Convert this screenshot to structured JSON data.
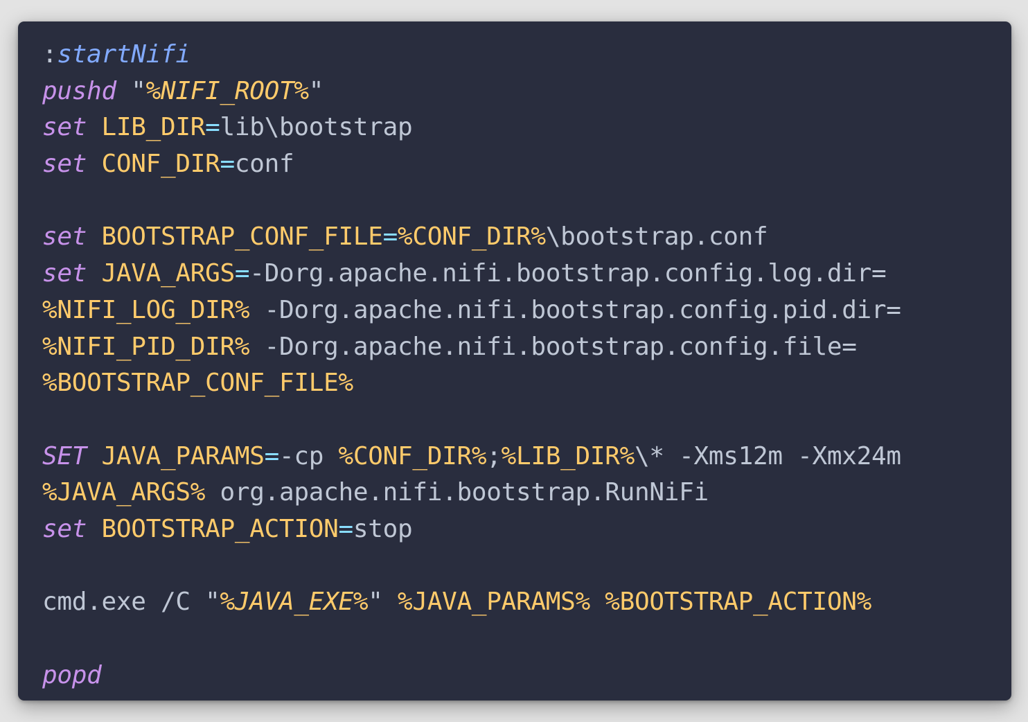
{
  "code": {
    "lines": [
      [
        {
          "t": ":",
          "k": "label-colon"
        },
        {
          "t": "startNifi",
          "k": "label-name"
        }
      ],
      [
        {
          "t": "pushd",
          "k": "kw"
        },
        {
          "t": " \"",
          "k": "plain"
        },
        {
          "t": "%NIFI_ROOT%",
          "k": "var-italic"
        },
        {
          "t": "\"",
          "k": "plain"
        }
      ],
      [
        {
          "t": "set",
          "k": "kw"
        },
        {
          "t": " ",
          "k": "plain"
        },
        {
          "t": "LIB_DIR",
          "k": "var"
        },
        {
          "t": "=",
          "k": "op"
        },
        {
          "t": "lib\\bootstrap",
          "k": "plain"
        }
      ],
      [
        {
          "t": "set",
          "k": "kw"
        },
        {
          "t": " ",
          "k": "plain"
        },
        {
          "t": "CONF_DIR",
          "k": "var"
        },
        {
          "t": "=",
          "k": "op"
        },
        {
          "t": "conf",
          "k": "plain"
        }
      ],
      [],
      [
        {
          "t": "set",
          "k": "kw"
        },
        {
          "t": " ",
          "k": "plain"
        },
        {
          "t": "BOOTSTRAP_CONF_FILE",
          "k": "var"
        },
        {
          "t": "=",
          "k": "op"
        },
        {
          "t": "%CONF_DIR%",
          "k": "var"
        },
        {
          "t": "\\bootstrap.conf",
          "k": "plain"
        }
      ],
      [
        {
          "t": "set",
          "k": "kw"
        },
        {
          "t": " ",
          "k": "plain"
        },
        {
          "t": "JAVA_ARGS",
          "k": "var"
        },
        {
          "t": "=",
          "k": "op"
        },
        {
          "t": "-Dorg.apache.nifi.bootstrap.config.log.dir=",
          "k": "plain"
        }
      ],
      [
        {
          "t": "%NIFI_LOG_DIR%",
          "k": "var"
        },
        {
          "t": " -Dorg.apache.nifi.bootstrap.config.pid.dir=",
          "k": "plain"
        }
      ],
      [
        {
          "t": "%NIFI_PID_DIR%",
          "k": "var"
        },
        {
          "t": " -Dorg.apache.nifi.bootstrap.config.file=",
          "k": "plain"
        }
      ],
      [
        {
          "t": "%BOOTSTRAP_CONF_FILE%",
          "k": "var"
        }
      ],
      [],
      [
        {
          "t": "SET",
          "k": "kw"
        },
        {
          "t": " ",
          "k": "plain"
        },
        {
          "t": "JAVA_PARAMS",
          "k": "var"
        },
        {
          "t": "=",
          "k": "op"
        },
        {
          "t": "-cp ",
          "k": "plain"
        },
        {
          "t": "%CONF_DIR%",
          "k": "var"
        },
        {
          "t": ";",
          "k": "plain"
        },
        {
          "t": "%LIB_DIR%",
          "k": "var"
        },
        {
          "t": "\\* -Xms12m -Xmx24m",
          "k": "plain"
        }
      ],
      [
        {
          "t": "%JAVA_ARGS%",
          "k": "var"
        },
        {
          "t": " org.apache.nifi.bootstrap.RunNiFi",
          "k": "plain"
        }
      ],
      [
        {
          "t": "set",
          "k": "kw"
        },
        {
          "t": " ",
          "k": "plain"
        },
        {
          "t": "BOOTSTRAP_ACTION",
          "k": "var"
        },
        {
          "t": "=",
          "k": "op"
        },
        {
          "t": "stop",
          "k": "plain"
        }
      ],
      [],
      [
        {
          "t": "cmd.exe /C \"",
          "k": "plain"
        },
        {
          "t": "%JAVA_EXE%",
          "k": "var-italic"
        },
        {
          "t": "\" ",
          "k": "plain"
        },
        {
          "t": "%JAVA_PARAMS%",
          "k": "var"
        },
        {
          "t": " ",
          "k": "plain"
        },
        {
          "t": "%BOOTSTRAP_ACTION%",
          "k": "var"
        }
      ],
      [],
      [
        {
          "t": "popd",
          "k": "kw"
        }
      ]
    ]
  },
  "colors": {
    "background": "#292d3e",
    "page": "#e3e3e3",
    "keyword": "#c792ea",
    "variable": "#ffcb6b",
    "label": "#82aaff",
    "operator": "#89ddff",
    "plain": "#bfc7d5"
  }
}
